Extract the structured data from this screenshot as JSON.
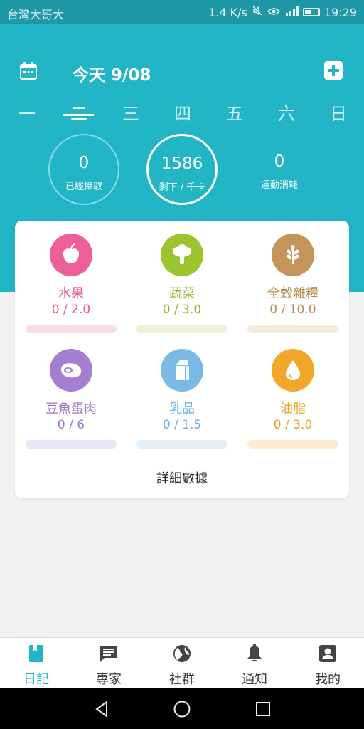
{
  "status_bar": {
    "carrier": "台灣大哥大",
    "speed": "1.4 K/s",
    "time": "19:29",
    "icons": [
      "mute-icon",
      "eye-icon",
      "signal-icon",
      "battery-icon"
    ]
  },
  "header": {
    "title": "今天 9/08",
    "left_icon": "calendar-icon",
    "right_icon": "add-icon",
    "background": "#21b5c6"
  },
  "weekdays": [
    "一",
    "二",
    "三",
    "四",
    "五",
    "六",
    "日"
  ],
  "selected_weekday": "二",
  "stats": {
    "intake": {
      "value": "0",
      "label": "已經攝取"
    },
    "remaining": {
      "value": "1586",
      "label": "剩下 / 千卡"
    },
    "exercise": {
      "value": "0",
      "label": "運動消耗"
    }
  },
  "categories": [
    {
      "name": "水果",
      "amount": "0 / 2.0",
      "icon": "apple-icon",
      "color": "#ec5f97",
      "track": "#f9dde8"
    },
    {
      "name": "蔬菜",
      "amount": "0 / 3.0",
      "icon": "broccoli-icon",
      "color": "#9cc42e",
      "track": "#ebf2d8"
    },
    {
      "name": "全穀雜糧",
      "amount": "0 / 10.0",
      "icon": "wheat-icon",
      "color": "#c4955a",
      "track": "#f3ebde"
    },
    {
      "name": "豆魚蛋肉",
      "amount": "0 / 6",
      "icon": "meat-icon",
      "color": "#a47fd1",
      "track": "#ece5f7"
    },
    {
      "name": "乳品",
      "amount": "0 / 1.5",
      "icon": "milk-carton-icon",
      "color": "#7ab8e6",
      "track": "#e2eff9"
    },
    {
      "name": "油脂",
      "amount": "0 / 3.0",
      "icon": "oil-drop-icon",
      "color": "#f1a729",
      "track": "#fcecd2"
    }
  ],
  "details_label": "詳細數據",
  "bottom_nav": [
    {
      "label": "日記",
      "icon": "diary-icon",
      "active": true
    },
    {
      "label": "專家",
      "icon": "chat-icon",
      "active": false
    },
    {
      "label": "社群",
      "icon": "globe-icon",
      "active": false
    },
    {
      "label": "通知",
      "icon": "bell-icon",
      "active": false
    },
    {
      "label": "我的",
      "icon": "profile-icon",
      "active": false
    }
  ],
  "system_nav": [
    "back-icon",
    "home-icon",
    "recents-icon"
  ],
  "colors": {
    "accent": "#21b5c6",
    "status_bar": "#1e97a6"
  }
}
